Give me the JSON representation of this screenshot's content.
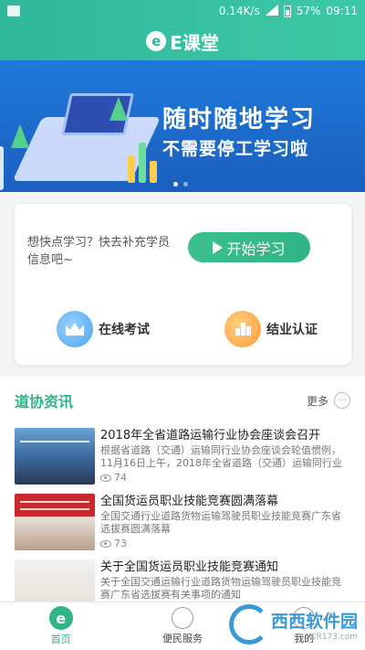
{
  "status_bar": {
    "speed": "0.14K/s",
    "battery": "57%",
    "time": "09:11"
  },
  "header": {
    "logo_letter": "e",
    "title": "E课堂"
  },
  "banner": {
    "line1": "随时随地学习",
    "line2": "不需要停工学习啦",
    "slides": 2,
    "active_slide": 1
  },
  "card": {
    "prompt": "想快点学习？快去补充学员信息吧~",
    "start_label": "开始学习",
    "actions": [
      {
        "label": "在线考试",
        "icon": "crown-icon"
      },
      {
        "label": "结业认证",
        "icon": "certificate-icon"
      }
    ]
  },
  "news": {
    "title": "道协资讯",
    "more_label": "更多",
    "items": [
      {
        "title": "2018年全省道路运输行业协会座谈会召开",
        "desc": "根据省道路（交通）运输同行业协会座谈会轮值惯例，11月16日上午，2018年全省道路（交通）运输同行业",
        "views": "74"
      },
      {
        "title": "全国货运员职业技能竞赛圆满落幕",
        "desc": "全国交通行业道路货物运输驾驶员职业技能竞赛广东省选拔赛圆满落幕",
        "views": "73"
      },
      {
        "title": "关于全国货运员职业技能竞赛通知",
        "desc": "关于全国交通运输行业道路货物运输驾驶员职业技能竞赛广东省选拔赛有关事项的通知",
        "views": ""
      }
    ]
  },
  "tabbar": {
    "tabs": [
      {
        "label": "首页",
        "active": true
      },
      {
        "label": "便民服务",
        "active": false
      },
      {
        "label": "我的",
        "active": false
      }
    ]
  },
  "watermark": {
    "text": "西西软件园",
    "url": "CR173.com"
  },
  "colors": {
    "brand": "#2fb486",
    "banner": "#1f7ad7",
    "exam": "#4aa6ee",
    "cert": "#ff9a3a"
  }
}
